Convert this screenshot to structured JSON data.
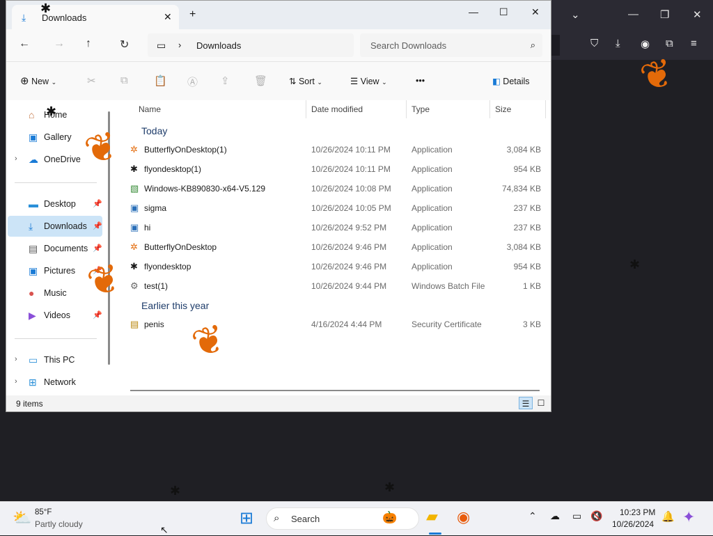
{
  "explorer": {
    "tab_title": "Downloads",
    "close_tab": "✕",
    "new_tab": "+",
    "minimize": "—",
    "maximize": "☐",
    "close": "✕",
    "crumb": "Downloads",
    "search_placeholder": "Search Downloads",
    "new_label": "New",
    "sort_label": "Sort",
    "view_label": "View",
    "more_label": "•••",
    "details_label": "Details"
  },
  "nav": {
    "items": [
      {
        "label": "Home"
      },
      {
        "label": "Gallery"
      },
      {
        "label": "OneDrive"
      },
      {
        "label": "Desktop"
      },
      {
        "label": "Downloads"
      },
      {
        "label": "Documents"
      },
      {
        "label": "Pictures"
      },
      {
        "label": "Music"
      },
      {
        "label": "Videos"
      },
      {
        "label": "This PC"
      },
      {
        "label": "Network"
      }
    ]
  },
  "columns": {
    "name": "Name",
    "date": "Date modified",
    "type": "Type",
    "size": "Size"
  },
  "groups": {
    "today": "Today",
    "earlier": "Earlier this year"
  },
  "files": [
    {
      "name": "ButterflyOnDesktop(1)",
      "date": "10/26/2024 10:11 PM",
      "type": "Application",
      "size": "3,084 KB"
    },
    {
      "name": "flyondesktop(1)",
      "date": "10/26/2024 10:11 PM",
      "type": "Application",
      "size": "954 KB"
    },
    {
      "name": "Windows-KB890830-x64-V5.129",
      "date": "10/26/2024 10:08 PM",
      "type": "Application",
      "size": "74,834 KB"
    },
    {
      "name": "sigma",
      "date": "10/26/2024 10:05 PM",
      "type": "Application",
      "size": "237 KB"
    },
    {
      "name": "hi",
      "date": "10/26/2024 9:52 PM",
      "type": "Application",
      "size": "237 KB"
    },
    {
      "name": "ButterflyOnDesktop",
      "date": "10/26/2024 9:46 PM",
      "type": "Application",
      "size": "3,084 KB"
    },
    {
      "name": "flyondesktop",
      "date": "10/26/2024 9:46 PM",
      "type": "Application",
      "size": "954 KB"
    },
    {
      "name": "test(1)",
      "date": "10/26/2024 9:44 PM",
      "type": "Windows Batch File",
      "size": "1 KB"
    },
    {
      "name": "penis",
      "date": "4/16/2024 4:44 PM",
      "type": "Security Certificate",
      "size": "3 KB"
    }
  ],
  "status": {
    "count": "9 items"
  },
  "taskbar": {
    "temp": "85°F",
    "weather": "Partly cloudy",
    "search_placeholder": "Search",
    "time": "10:23 PM",
    "date": "10/26/2024"
  }
}
